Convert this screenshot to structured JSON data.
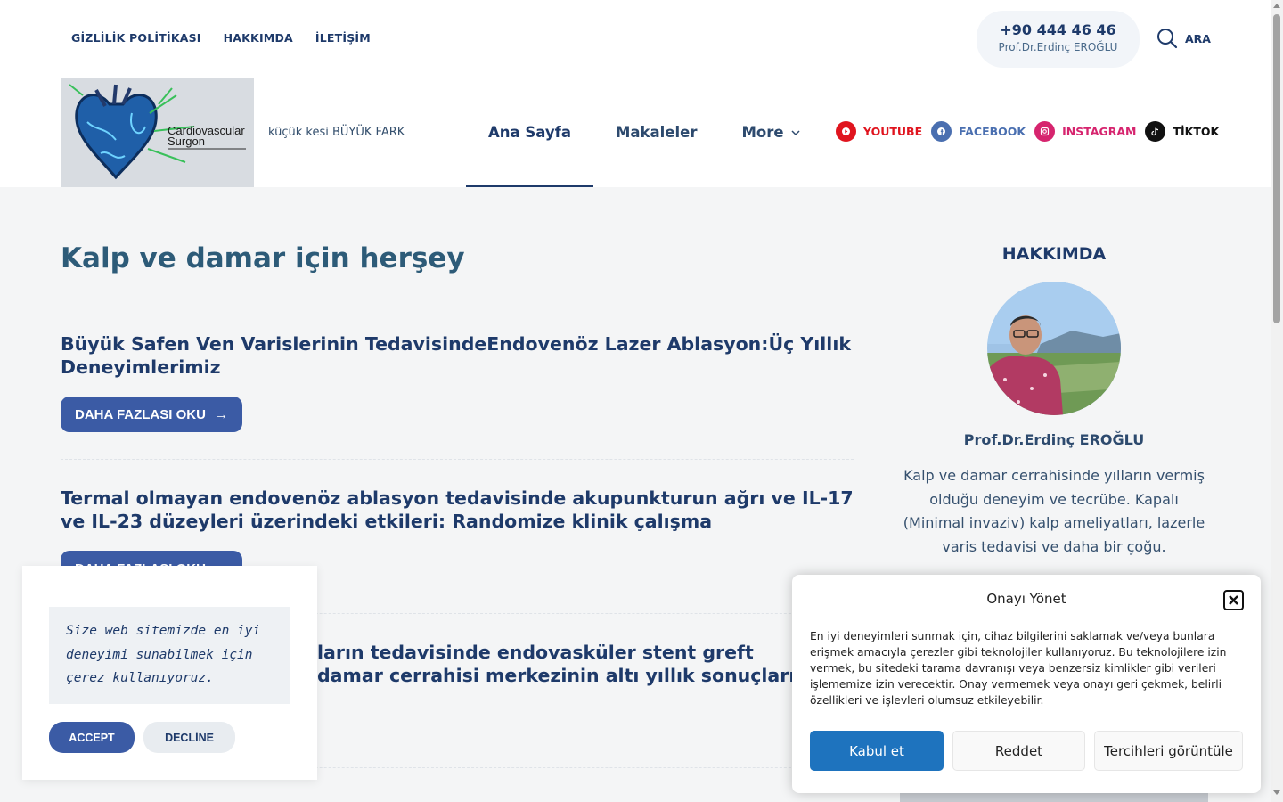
{
  "top_links": [
    "GİZLİLİK POLİTİKASI",
    "HAKKIMDA",
    "İLETİŞİM"
  ],
  "phone": {
    "number": "+90 444 46 46",
    "name": "Prof.Dr.Erdinç EROĞLU"
  },
  "search": {
    "label": "ARA",
    "icon": "search-icon"
  },
  "logo": {
    "line1": "Cardiovascular",
    "line2": "Surgon",
    "icon": "heart-logo"
  },
  "tagline": "küçük kesi BÜYÜK FARK",
  "nav": {
    "items": [
      "Ana Sayfa",
      "Makaleler",
      "More"
    ],
    "active": "Ana Sayfa"
  },
  "socials": [
    {
      "label": "YOUTUBE",
      "color": "#e0141e",
      "icon": "youtube-icon"
    },
    {
      "label": "FACEBOOK",
      "color": "#4a6fb0",
      "icon": "facebook-icon"
    },
    {
      "label": "INSTAGRAM",
      "color": "#d6246e",
      "icon": "instagram-icon"
    },
    {
      "label": "TİKTOK",
      "color": "#111111",
      "icon": "tiktok-icon"
    }
  ],
  "main": {
    "title": "Kalp ve damar için herşey",
    "read_more_label": "DAHA FAZLASI OKU",
    "posts": [
      "Büyük Safen Ven Varislerinin TedavisindeEndovenöz Lazer Ablasyon:Üç Yıllık Deneyimlerimiz",
      "Termal olmayan endovenöz ablasyon tedavisinde akupunkturun ağrı ve IL-17 ve IL-23 düzeyleri üzerindeki etkileri: Randomize klinik çalışma"
    ],
    "post3_visible_part1": "ların tedavisinde endovasküler stent greft",
    "post3_visible_part2": "damar cerrahisi merkezinin altı yıllık sonuçları"
  },
  "sidebar": {
    "heading": "HAKKIMDA",
    "name": "Prof.Dr.Erdinç EROĞLU",
    "bio": "Kalp ve damar cerrahisinde yılların vermiş olduğu deneyim ve tecrübe. Kapalı (Minimal invaziv) kalp ameliyatları, lazerle varis tedavisi ve daha bir çoğu."
  },
  "cookie_bar": {
    "message": "Size web sitemizde en iyi deneyimi sunabilmek için çerez kullanıyoruz.",
    "accept": "ACCEPT",
    "decline": "DECLİNE"
  },
  "consent": {
    "title": "Onayı Yönet",
    "text": "En iyi deneyimleri sunmak için, cihaz bilgilerini saklamak ve/veya bunlara erişmek amacıyla çerezler gibi teknolojiler kullanıyoruz. Bu teknolojilere izin vermek, bu sitedeki tarama davranışı veya benzersiz kimlikler gibi verileri işlememize izin verecektir. Onay vermemek veya onayı geri çekmek, belirli özellikleri ve işlevleri olumsuz etkileyebilir.",
    "accept": "Kabul et",
    "deny": "Reddet",
    "preferences": "Tercihleri görüntüle"
  },
  "colors": {
    "primary": "#1e3a6a",
    "button": "#3b5ba5",
    "consent_accept": "#1e73be"
  }
}
